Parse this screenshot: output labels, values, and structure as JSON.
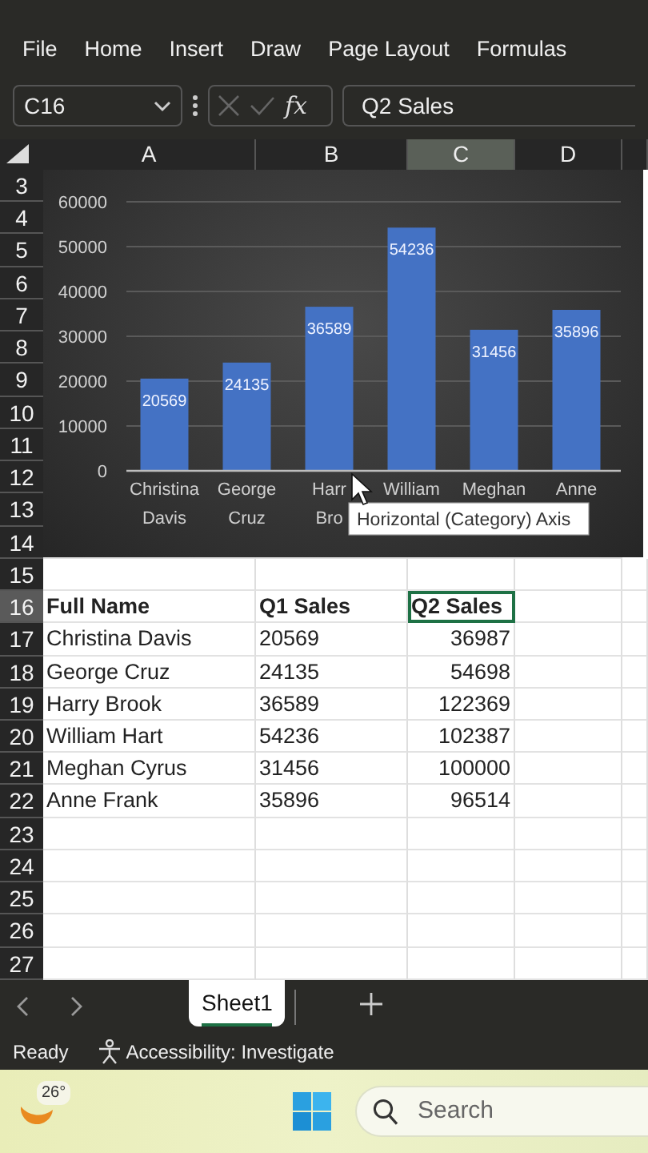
{
  "ribbon_tabs": [
    {
      "label": "File"
    },
    {
      "label": "Home"
    },
    {
      "label": "Insert"
    },
    {
      "label": "Draw"
    },
    {
      "label": "Page Layout"
    },
    {
      "label": "Formulas"
    }
  ],
  "formula_bar": {
    "name_box": "C16",
    "function_label": "fx",
    "formula": "Q2 Sales"
  },
  "columns": [
    {
      "label": "A",
      "selected": false
    },
    {
      "label": "B",
      "selected": false
    },
    {
      "label": "C",
      "selected": true
    },
    {
      "label": "D",
      "selected": false
    }
  ],
  "rows": [
    {
      "number": "3",
      "selected": false
    },
    {
      "number": "4",
      "selected": false
    },
    {
      "number": "5",
      "selected": false
    },
    {
      "number": "6",
      "selected": false
    },
    {
      "number": "7",
      "selected": false
    },
    {
      "number": "8",
      "selected": false
    },
    {
      "number": "9",
      "selected": false
    },
    {
      "number": "10",
      "selected": false
    },
    {
      "number": "11",
      "selected": false
    },
    {
      "number": "12",
      "selected": false
    },
    {
      "number": "13",
      "selected": false
    },
    {
      "number": "14",
      "selected": false
    },
    {
      "number": "15",
      "selected": false
    },
    {
      "number": "16",
      "selected": true,
      "cells": [
        {
          "text": "Full Name",
          "kind": "header",
          "selected": false
        },
        {
          "text": "Q1 Sales",
          "kind": "header",
          "selected": false
        },
        {
          "text": "Q2 Sales",
          "kind": "header",
          "selected": true
        }
      ]
    },
    {
      "number": "17",
      "selected": false,
      "cells": [
        {
          "text": "Christina Davis",
          "kind": "text",
          "selected": false
        },
        {
          "text": "20569",
          "kind": "text",
          "selected": false
        },
        {
          "text": "36987",
          "kind": "number",
          "selected": false
        }
      ]
    },
    {
      "number": "18",
      "selected": false,
      "cells": [
        {
          "text": "George Cruz",
          "kind": "text",
          "selected": false
        },
        {
          "text": "24135",
          "kind": "text",
          "selected": false
        },
        {
          "text": "54698",
          "kind": "number",
          "selected": false
        }
      ]
    },
    {
      "number": "19",
      "selected": false,
      "cells": [
        {
          "text": "Harry Brook",
          "kind": "text",
          "selected": false
        },
        {
          "text": "36589",
          "kind": "text",
          "selected": false
        },
        {
          "text": "122369",
          "kind": "number",
          "selected": false
        }
      ]
    },
    {
      "number": "20",
      "selected": false,
      "cells": [
        {
          "text": "William Hart",
          "kind": "text",
          "selected": false
        },
        {
          "text": "54236",
          "kind": "text",
          "selected": false
        },
        {
          "text": "102387",
          "kind": "number",
          "selected": false
        }
      ]
    },
    {
      "number": "21",
      "selected": false,
      "cells": [
        {
          "text": "Meghan Cyrus",
          "kind": "text",
          "selected": false
        },
        {
          "text": "31456",
          "kind": "text",
          "selected": false
        },
        {
          "text": "100000",
          "kind": "number",
          "selected": false
        }
      ]
    },
    {
      "number": "22",
      "selected": false,
      "cells": [
        {
          "text": "Anne Frank",
          "kind": "text",
          "selected": false
        },
        {
          "text": "35896",
          "kind": "text",
          "selected": false
        },
        {
          "text": "96514",
          "kind": "number",
          "selected": false
        }
      ]
    },
    {
      "number": "23",
      "selected": false
    },
    {
      "number": "24",
      "selected": false
    },
    {
      "number": "25",
      "selected": false
    },
    {
      "number": "26",
      "selected": false
    },
    {
      "number": "27",
      "selected": false
    }
  ],
  "chart": {
    "tooltip": "Horizontal (Category) Axis",
    "chart_data": {
      "type": "bar",
      "categories": [
        "Christina Davis",
        "George Cruz",
        "Harr Bro",
        "William",
        "Meghan",
        "Anne"
      ],
      "series": [
        {
          "color": "#4472c4",
          "values": [
            20569,
            24135,
            36589,
            54236,
            31456,
            35896
          ]
        }
      ],
      "ylim": [
        0,
        60000
      ],
      "yticks": [
        0,
        10000,
        20000,
        30000,
        40000,
        50000,
        60000
      ],
      "grid": true,
      "data_labels": true
    }
  },
  "sheet_tabs": [
    {
      "label": "Sheet1",
      "selected": true
    }
  ],
  "status_bar": {
    "mode": "Ready",
    "accessibility": "Accessibility: Investigate"
  },
  "taskbar": {
    "temperature": "26°",
    "search_placeholder": "Search"
  }
}
